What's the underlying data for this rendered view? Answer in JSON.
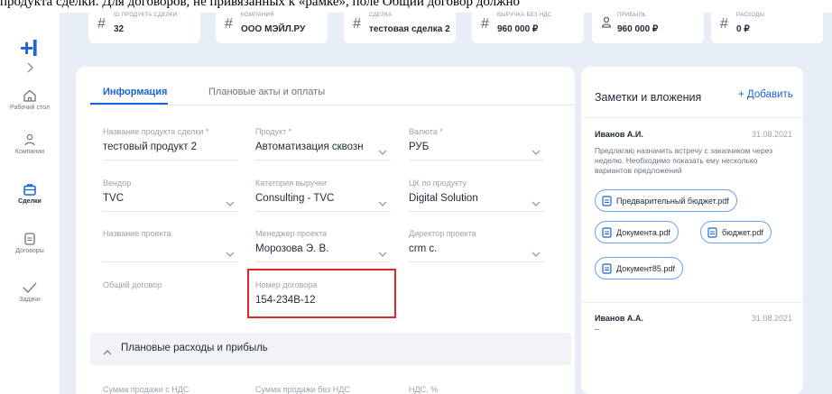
{
  "caption": "продукта сделки. Для договоров, не привязанных к «рамке», поле Общий договор должно",
  "sidebar": {
    "logo": "+I",
    "expand_icon": "chevron-right-icon",
    "items": [
      {
        "label": "Рабочий стол",
        "icon": "home-icon"
      },
      {
        "label": "Компании",
        "icon": "users-icon"
      },
      {
        "label": "Сделки",
        "icon": "briefcase-icon",
        "active": true
      },
      {
        "label": "Договоры",
        "icon": "document-icon"
      },
      {
        "label": "Задачи",
        "icon": "check-icon"
      }
    ]
  },
  "metrics": [
    {
      "label": "ID ПРОДУКТА СДЕЛКИ",
      "value": "32",
      "icon": "hash-icon"
    },
    {
      "label": "КОМПАНИЯ",
      "value": "ООО МЭЙЛ.РУ",
      "icon": "hash-icon"
    },
    {
      "label": "СДЕЛКА",
      "value": "тестовая сделка 2",
      "icon": "hash-icon"
    },
    {
      "label": "ВЫРУЧКА БЕЗ НДС",
      "value": "960 000 ₽",
      "icon": "hash-icon"
    },
    {
      "label": "ПРИБЫЛЬ",
      "value": "960 000 ₽",
      "icon": "person-icon"
    },
    {
      "label": "РАСХОДЫ",
      "value": "0 ₽",
      "icon": "hash-icon"
    }
  ],
  "tabs": [
    {
      "label": "Информация",
      "active": true
    },
    {
      "label": "Плановые акты и оплаты",
      "active": false
    }
  ],
  "fields": {
    "product_name": {
      "label": "Название продукта сделки *",
      "value": "тестовый продукт 2"
    },
    "product": {
      "label": "Продукт *",
      "value": "Автоматизация сквозн"
    },
    "currency": {
      "label": "Валюта *",
      "value": "РУБ"
    },
    "vendor": {
      "label": "Вендор",
      "value": "TVC"
    },
    "revenue_category": {
      "label": "Категория выручки",
      "value": "Consulting - TVC"
    },
    "product_cc": {
      "label": "ЦК по продукту",
      "value": "Digital Solution"
    },
    "project_name": {
      "label": "Название проекта",
      "value": ""
    },
    "project_manager": {
      "label": "Менеджер проекта",
      "value": "Морозова Э. В."
    },
    "project_director": {
      "label": "Директор проекта",
      "value": "crm c."
    },
    "general_contract": {
      "label": "Общий договор",
      "value": ""
    },
    "contract_number": {
      "label": "Номер договора",
      "value": "154-234В-12"
    }
  },
  "section": {
    "title": "Плановые расходы и прибыль",
    "expanded": true
  },
  "bottom_labels": [
    "Сумма продажи с НДС",
    "Сумма продажи без НДС",
    "НДС, %"
  ],
  "notes": {
    "title": "Заметки и вложения",
    "add_label": "+ Добавить",
    "items": [
      {
        "author": "Иванов А.И.",
        "date": "31.08.2021",
        "text": "Предлагаю назначить встречу с заказчиком через неделю. Необходимо показать ему несколько вариантов предложений",
        "attachments": [
          "Предварительный бюджет.pdf",
          "Документа.pdf",
          "бюджет.pdf",
          "Документ85.pdf"
        ]
      },
      {
        "author": "Иванов А.А.",
        "date": "31.08.2021",
        "text": "–"
      }
    ]
  },
  "colors": {
    "accent": "#1b63d6",
    "highlight": "#e0262b",
    "background": "#e7eef8"
  }
}
